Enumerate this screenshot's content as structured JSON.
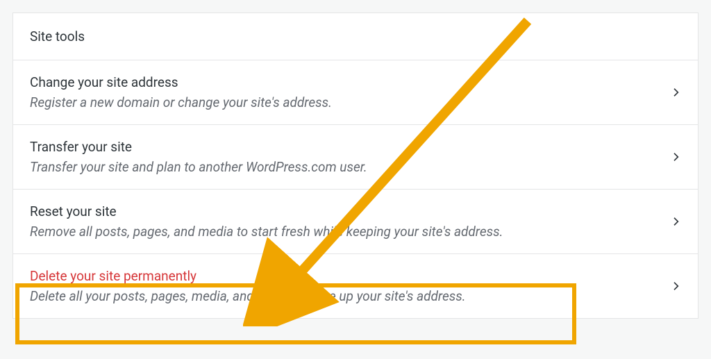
{
  "header": {
    "title": "Site tools"
  },
  "rows": {
    "change_address": {
      "title": "Change your site address",
      "desc": "Register a new domain or change your site's address."
    },
    "transfer": {
      "title": "Transfer your site",
      "desc": "Transfer your site and plan to another WordPress.com user."
    },
    "reset": {
      "title": "Reset your site",
      "desc": "Remove all posts, pages, and media to start fresh while keeping your site's address."
    },
    "delete": {
      "title": "Delete your site permanently",
      "desc": "Delete all your posts, pages, media, and data, and give up your site's address."
    }
  }
}
